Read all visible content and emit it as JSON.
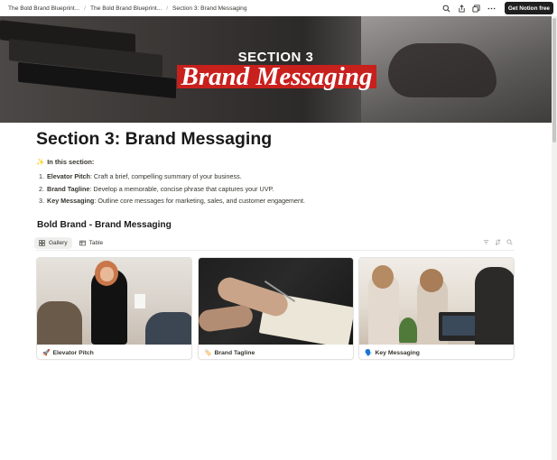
{
  "breadcrumbs": [
    "The Bold Brand Blueprint...",
    "The Bold Brand Blueprint...",
    "Section 3: Brand Messaging"
  ],
  "top_actions": {
    "search_icon": "search-icon",
    "share_icon": "share-icon",
    "duplicate_icon": "duplicate-icon",
    "more_icon": "more-icon",
    "cta_label": "Get Notion free"
  },
  "cover": {
    "section_label": "SECTION 3",
    "title": "Brand Messaging",
    "band_color": "#c8201d"
  },
  "page": {
    "title": "Section 3: Brand Messaging",
    "callout_emoji": "✨",
    "callout_text": "In this section:",
    "items": [
      {
        "num": "1.",
        "term": "Elevator Pitch",
        "desc": ": Craft a brief, compelling summary of your business."
      },
      {
        "num": "2.",
        "term": "Brand Tagline",
        "desc": ": Develop a memorable, concise phrase that captures your UVP."
      },
      {
        "num": "3.",
        "term": "Key Messaging",
        "desc": ": Outline core messages for marketing, sales, and customer engagement."
      }
    ]
  },
  "database": {
    "title": "Bold Brand - Brand Messaging",
    "tabs": [
      {
        "label": "Gallery",
        "icon": "gallery-icon",
        "active": true
      },
      {
        "label": "Table",
        "icon": "table-icon",
        "active": false
      }
    ],
    "tools": [
      "filter-icon",
      "sort-icon",
      "search-icon"
    ],
    "cards": [
      {
        "emoji": "🚀",
        "label": "Elevator Pitch"
      },
      {
        "emoji": "🏷️",
        "label": "Brand Tagline"
      },
      {
        "emoji": "🗣️",
        "label": "Key Messaging"
      }
    ]
  }
}
